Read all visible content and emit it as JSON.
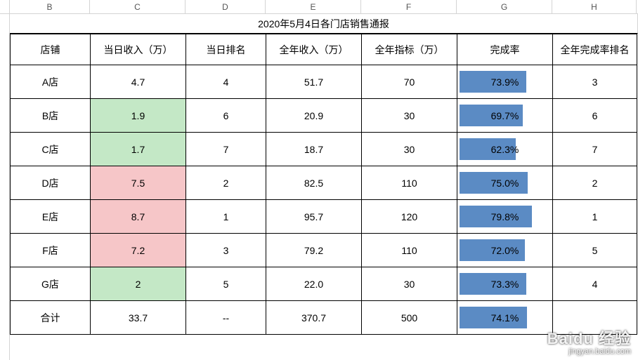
{
  "columns": [
    "B",
    "C",
    "D",
    "E",
    "F",
    "G",
    "H"
  ],
  "title": "2020年5月4日各门店销售通报",
  "headers": {
    "store": "店铺",
    "daily_income": "当日收入（万）",
    "daily_rank": "当日排名",
    "year_income": "全年收入（万）",
    "year_target": "全年指标（万）",
    "completion": "完成率",
    "year_rank": "全年完成率排名"
  },
  "rows": [
    {
      "store": "A店",
      "daily_income": "4.7",
      "daily_rank": "4",
      "year_income": "51.7",
      "year_target": "70",
      "completion": "73.9%",
      "comp_pct": 73.9,
      "year_rank": "3",
      "c_fill": ""
    },
    {
      "store": "B店",
      "daily_income": "1.9",
      "daily_rank": "6",
      "year_income": "20.9",
      "year_target": "30",
      "completion": "69.7%",
      "comp_pct": 69.7,
      "year_rank": "6",
      "c_fill": "green"
    },
    {
      "store": "C店",
      "daily_income": "1.7",
      "daily_rank": "7",
      "year_income": "18.7",
      "year_target": "30",
      "completion": "62.3%",
      "comp_pct": 62.3,
      "year_rank": "7",
      "c_fill": "green"
    },
    {
      "store": "D店",
      "daily_income": "7.5",
      "daily_rank": "2",
      "year_income": "82.5",
      "year_target": "110",
      "completion": "75.0%",
      "comp_pct": 75.0,
      "year_rank": "2",
      "c_fill": "pink"
    },
    {
      "store": "E店",
      "daily_income": "8.7",
      "daily_rank": "1",
      "year_income": "95.7",
      "year_target": "120",
      "completion": "79.8%",
      "comp_pct": 79.8,
      "year_rank": "1",
      "c_fill": "pink"
    },
    {
      "store": "F店",
      "daily_income": "7.2",
      "daily_rank": "3",
      "year_income": "79.2",
      "year_target": "110",
      "completion": "72.0%",
      "comp_pct": 72.0,
      "year_rank": "5",
      "c_fill": "pink"
    },
    {
      "store": "G店",
      "daily_income": "2",
      "daily_rank": "5",
      "year_income": "22.0",
      "year_target": "30",
      "completion": "73.3%",
      "comp_pct": 73.3,
      "year_rank": "4",
      "c_fill": "green"
    }
  ],
  "total": {
    "label": "合计",
    "daily_income": "33.7",
    "daily_rank": "--",
    "year_income": "370.7",
    "year_target": "500",
    "completion": "74.1%",
    "comp_pct": 74.1,
    "year_rank": ""
  },
  "chart_data": {
    "type": "bar",
    "title": "完成率",
    "categories": [
      "A店",
      "B店",
      "C店",
      "D店",
      "E店",
      "F店",
      "G店",
      "合计"
    ],
    "values": [
      73.9,
      69.7,
      62.3,
      75.0,
      79.8,
      72.0,
      73.3,
      74.1
    ],
    "ylim": [
      0,
      100
    ],
    "xlabel": "",
    "ylabel": "完成率 %"
  },
  "watermark": {
    "main": "Baidu 经验",
    "sub": "jingyan.baidu.com"
  }
}
